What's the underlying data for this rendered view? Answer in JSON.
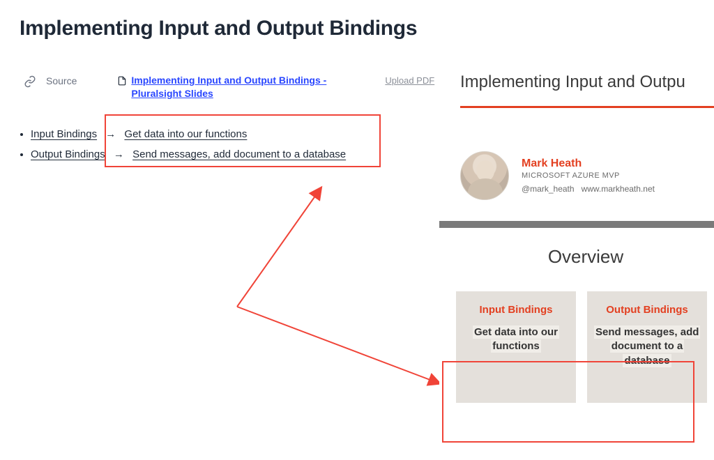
{
  "title": "Implementing Input and Output Bindings",
  "source": {
    "label": "Source",
    "link_text": "Implementing Input and Output Bindings - Pluralsight Slides",
    "upload_text": "Upload PDF"
  },
  "bullets": [
    {
      "term": "Input Bindings",
      "desc": "Get data into our   functions"
    },
    {
      "term": "Output Bindings",
      "desc": "Send messages,   add document to   a database"
    }
  ],
  "arrow_glyph": "→",
  "slide": {
    "title": "Implementing Input and Outpu",
    "author": {
      "name": "Mark Heath",
      "role": "MICROSOFT AZURE MVP",
      "handle": "@mark_heath",
      "site": "www.markheath.net"
    },
    "overview_heading": "Overview",
    "cards": [
      {
        "heading": "Input Bindings",
        "body": "Get data into our functions"
      },
      {
        "heading": "Output Bindings",
        "body": "Send messages, add document to a database"
      }
    ]
  }
}
